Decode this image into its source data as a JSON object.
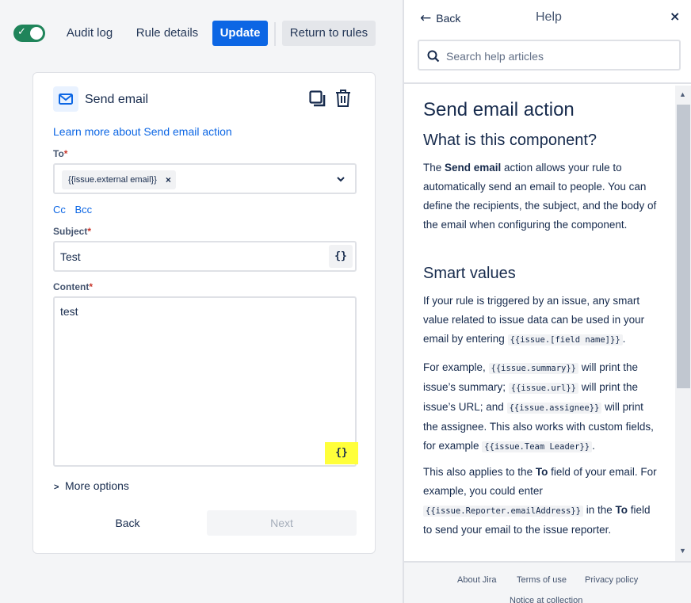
{
  "topbar": {
    "toggle_state": "on",
    "audit_log": "Audit log",
    "rule_details": "Rule details",
    "update": "Update",
    "return_to_rules": "Return to rules"
  },
  "card": {
    "title": "Send email",
    "learn_more": "Learn more about Send email action",
    "to_label": "To",
    "required_mark": "*",
    "to_chip": "{{issue.external email}}",
    "chip_remove": "×",
    "cc": "Cc",
    "bcc": "Bcc",
    "subject_label": "Subject",
    "subject_value": "Test",
    "content_label": "Content",
    "content_value": "test",
    "smart_value_button": "{}",
    "more_options": "More options",
    "back": "Back",
    "next": "Next"
  },
  "help": {
    "back": "Back",
    "title": "Help",
    "close": "×",
    "search_placeholder": "Search help articles",
    "article_title": "Send email action",
    "section1_title": "What is this component?",
    "section1": {
      "pre": "The ",
      "bold": "Send email",
      "post": " action allows your rule to automatically send an email to people. You can define the recipients, the subject, and the body of the email when configuring the component."
    },
    "section2_title": "Smart values",
    "p2": {
      "pre": "If your rule is triggered by an issue, any smart value related to issue data can be used in your email by entering ",
      "code": "{{issue.[field name]}}",
      "post": "."
    },
    "p3": {
      "t1": "For example, ",
      "c1": "{{issue.summary}}",
      "t2": " will print the issue’s summary; ",
      "c2": "{{issue.url}}",
      "t3": " will print the issue’s URL; and ",
      "c3": "{{issue.assignee}}",
      "t4": " will print the assignee. This also works with custom fields, for example ",
      "c4": "{{issue.Team Leader}}",
      "t5": "."
    },
    "p4": {
      "t1": "This also applies to the ",
      "b1": "To",
      "t2": " field of your email. For example, you could enter ",
      "c1": "{{issue.Reporter.emailAddress}}",
      "t3": " in the ",
      "b2": "To",
      "t4": " field to send your email to the issue reporter."
    },
    "footer": {
      "about": "About Jira",
      "terms": "Terms of use",
      "privacy": "Privacy policy",
      "notice": "Notice at collection"
    }
  },
  "colors": {
    "primary": "#0c66e4",
    "toggle_on": "#1f845a",
    "highlight": "#ffff3a",
    "required": "#c9372c"
  }
}
